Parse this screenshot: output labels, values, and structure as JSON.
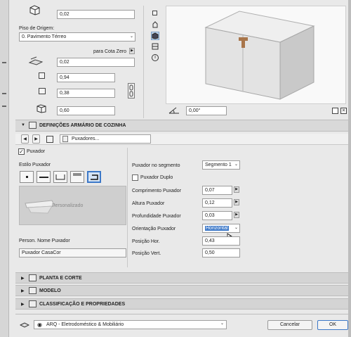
{
  "top": {
    "height_value": "0,02",
    "floor_label": "Piso de Origem:",
    "floor_value": "0. Pavimento Térreo",
    "to_zero_label": "para Cota Zero",
    "elevation_value": "0,02",
    "width_value": "0,94",
    "depth_value": "0,38",
    "size_value": "0,60",
    "rotation_value": "0,00°"
  },
  "section_main": {
    "title": "DEFINIÇÕES ARMÁRIO DE COZINHA"
  },
  "nav": {
    "page_label": "Puxadores..."
  },
  "handle": {
    "checkbox_label": "Puxador",
    "style_label": "Estilo Puxador",
    "preview_label": "Personalizado",
    "name_label": "Person. Nome Puxador",
    "name_value": "Puxador CasaCor",
    "segment_label": "Puxador no segmento",
    "segment_value": "Segmento 1",
    "double_label": "Puxador Duplo",
    "length_label": "Comprimento Puxador",
    "length_value": "0,07",
    "height_label": "Altura Puxador",
    "height_value": "0,12",
    "depth_label": "Profundidade Puxador",
    "depth_value": "0,03",
    "orientation_label": "Orientação Puxador",
    "orientation_value": "Horizontal",
    "hpos_label": "Posição Hor.",
    "hpos_value": "0,43",
    "vpos_label": "Posição Vert.",
    "vpos_value": "0,50"
  },
  "sections": {
    "plan": "PLANTA E CORTE",
    "model": "MODELO",
    "classification": "CLASSIFICAÇÃO E PROPRIEDADES"
  },
  "footer": {
    "layer_value": "ARQ - Eletrodoméstico & Mobiliário",
    "cancel_label": "Cancelar",
    "ok_label": "OK"
  },
  "colors": {
    "accent": "#3c78c8",
    "selection": "#3c78c8",
    "cabinet": "#e3e3e3",
    "handle": "#a8754a"
  }
}
